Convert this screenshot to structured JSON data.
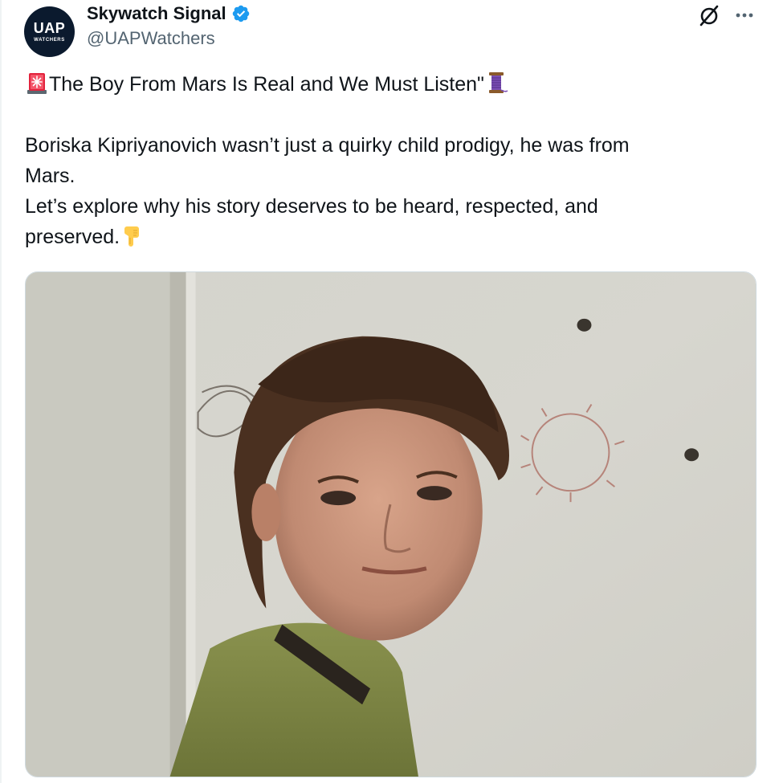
{
  "author": {
    "display_name": "Skywatch Signal",
    "handle": "@UAPWatchers",
    "verified": true,
    "avatar_text": "UAP",
    "avatar_subtext": "WATCHERS"
  },
  "tweet": {
    "title_line": "The Boy From Mars Is Real and We Must Listen\"",
    "lines": [
      "Boriska Kipriyanovich wasn’t just a quirky child prodigy, he was from",
      "Mars.",
      "Let’s explore why his story deserves to be heard, respected, and",
      "preserved."
    ]
  },
  "icons": {
    "title_prefix": "police-light-emoji",
    "title_suffix": "thread-emoji",
    "text_suffix": "pointing-down-emoji",
    "grok": "grok-icon",
    "more": "more-icon",
    "verified": "verified-badge-icon"
  },
  "colors": {
    "verified_blue": "#1d9bf0",
    "text_primary": "#0f1419",
    "text_secondary": "#536471"
  }
}
